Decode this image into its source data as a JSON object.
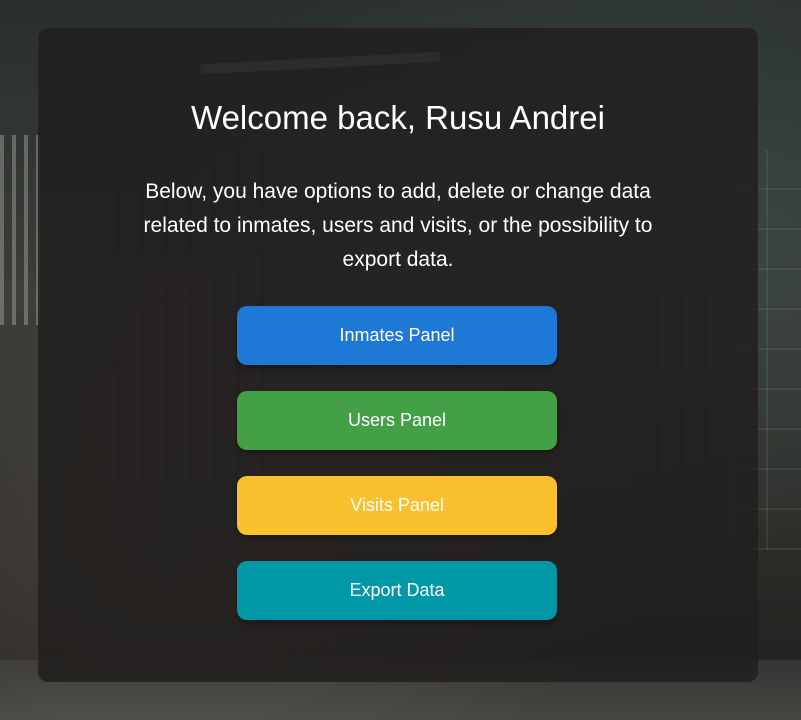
{
  "welcome": {
    "title": "Welcome back, Rusu Andrei",
    "description": "Below, you have options to add, delete or change data related to inmates, users and visits, or the possibility to export data."
  },
  "buttons": {
    "inmates": {
      "label": "Inmates Panel",
      "color": "#1e78d6"
    },
    "users": {
      "label": "Users Panel",
      "color": "#43a047"
    },
    "visits": {
      "label": "Visits Panel",
      "color": "#fbc02d"
    },
    "export": {
      "label": "Export Data",
      "color": "#0097a7"
    }
  }
}
